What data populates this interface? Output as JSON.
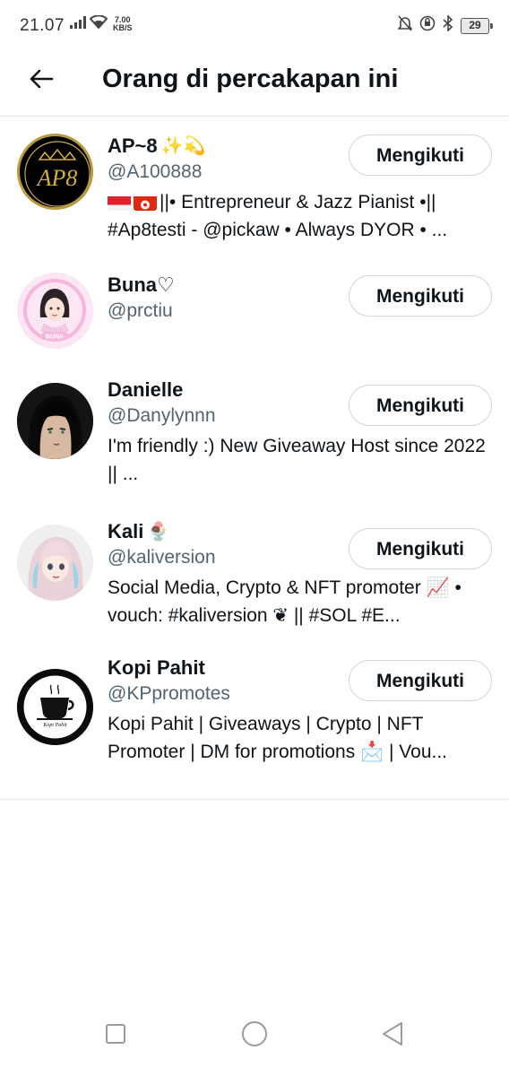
{
  "status_bar": {
    "time": "21.07",
    "speed_value": "7.00",
    "speed_unit": "KB/S",
    "battery": "29"
  },
  "header": {
    "title": "Orang di percakapan ini"
  },
  "users": [
    {
      "name": "AP~8",
      "name_emoji": "✨💫",
      "handle": "@A100888",
      "bio": "||• Entrepreneur & Jazz Pianist •|| #Ap8testi - @pickaw • Always DYOR • ...",
      "follow_label": "Mengikuti"
    },
    {
      "name": "Buna♡",
      "name_emoji": "",
      "handle": "@prctiu",
      "bio": "",
      "follow_label": "Mengikuti"
    },
    {
      "name": "Danielle",
      "name_emoji": "",
      "handle": "@Danylynnn",
      "bio": "I'm friendly :) New Giveaway Host since 2022 || ...",
      "follow_label": "Mengikuti"
    },
    {
      "name": "Kali",
      "name_emoji": "🍨",
      "handle": "@kaliversion",
      "bio": "Social Media, Crypto & NFT promoter 📈 • vouch: #kaliversion ❦ || #SOL #E...",
      "follow_label": "Mengikuti"
    },
    {
      "name": "Kopi Pahit",
      "name_emoji": "",
      "handle": "@KPpromotes",
      "bio": "Kopi Pahit | Giveaways | Crypto | NFT Promoter | DM for promotions 📩 | Vou...",
      "follow_label": "Mengikuti"
    }
  ],
  "avatar_texts": {
    "ap8": "AP8",
    "buna": "BUNA",
    "kopi": "Kopi Pahit"
  }
}
